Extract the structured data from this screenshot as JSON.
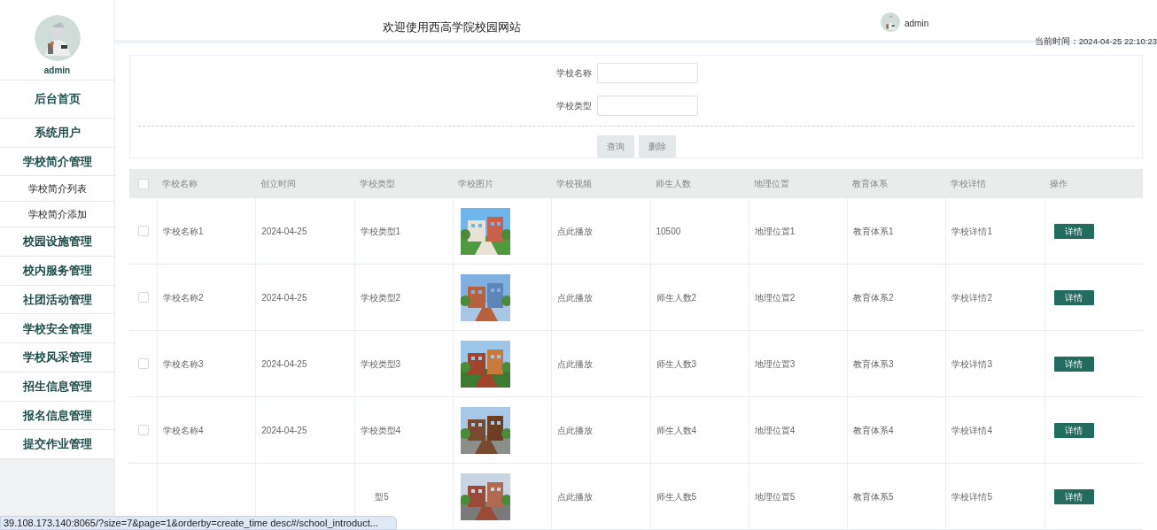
{
  "sidebar": {
    "user": {
      "name": "admin"
    },
    "menu": [
      {
        "label": "后台首页"
      },
      {
        "label": "系统用户"
      },
      {
        "label": "学校简介管理",
        "children": [
          {
            "label": "学校简介列表"
          },
          {
            "label": "学校简介添加"
          }
        ]
      },
      {
        "label": "校园设施管理"
      },
      {
        "label": "校内服务管理"
      },
      {
        "label": "社团活动管理"
      },
      {
        "label": "学校安全管理"
      },
      {
        "label": "学校风采管理"
      },
      {
        "label": "招生信息管理"
      },
      {
        "label": "报名信息管理"
      },
      {
        "label": "提交作业管理"
      }
    ]
  },
  "header": {
    "title": "欢迎使用西高学院校园网站",
    "user": "admin",
    "time": "当前时间：2024-04-25 22:10:23"
  },
  "search": {
    "fields": [
      {
        "label": "学校名称"
      },
      {
        "label": "学校类型"
      }
    ],
    "buttons": [
      "查询",
      "删除"
    ]
  },
  "table": {
    "header_checked": false,
    "columns": [
      "学校名称",
      "创立时间",
      "学校类型",
      "学校图片",
      "学校视频",
      "师生人数",
      "地理位置",
      "教育体系",
      "学校详情",
      "操作"
    ],
    "rows": [
      {
        "kind": "full",
        "checked": false,
        "name": "学校名称1",
        "created": "2024-04-25",
        "type": "学校类型1",
        "video": "点此播放",
        "count": "10500",
        "location": "地理位置1",
        "education": "教育体系1",
        "detail": "学校详情1",
        "action": "详情"
      },
      {
        "kind": "full",
        "checked": false,
        "name": "学校名称2",
        "created": "2024-04-25",
        "type": "学校类型2",
        "video": "点此播放",
        "count": "师生人数2",
        "location": "地理位置2",
        "education": "教育体系2",
        "detail": "学校详情2",
        "action": "详情"
      },
      {
        "kind": "full",
        "checked": false,
        "name": "学校名称3",
        "created": "2024-04-25",
        "type": "学校类型3",
        "video": "点此播放",
        "count": "师生人数3",
        "location": "地理位置3",
        "education": "教育体系3",
        "detail": "学校详情3",
        "action": "详情"
      },
      {
        "kind": "full",
        "checked": false,
        "name": "学校名称4",
        "created": "2024-04-25",
        "type": "学校类型4",
        "video": "点此播放",
        "count": "师生人数4",
        "location": "地理位置4",
        "education": "教育体系4",
        "detail": "学校详情4",
        "action": "详情"
      },
      {
        "kind": "covered",
        "type": "型5",
        "video": "点此播放",
        "count": "师生人数5",
        "location": "地理位置5",
        "education": "教育体系5",
        "detail": "学校详情5",
        "action": "详情"
      }
    ]
  },
  "status_bar": {
    "url": "39.108.173.140:8065/?size=7&page=1&orderby=create_time desc#/school_introduct..."
  }
}
